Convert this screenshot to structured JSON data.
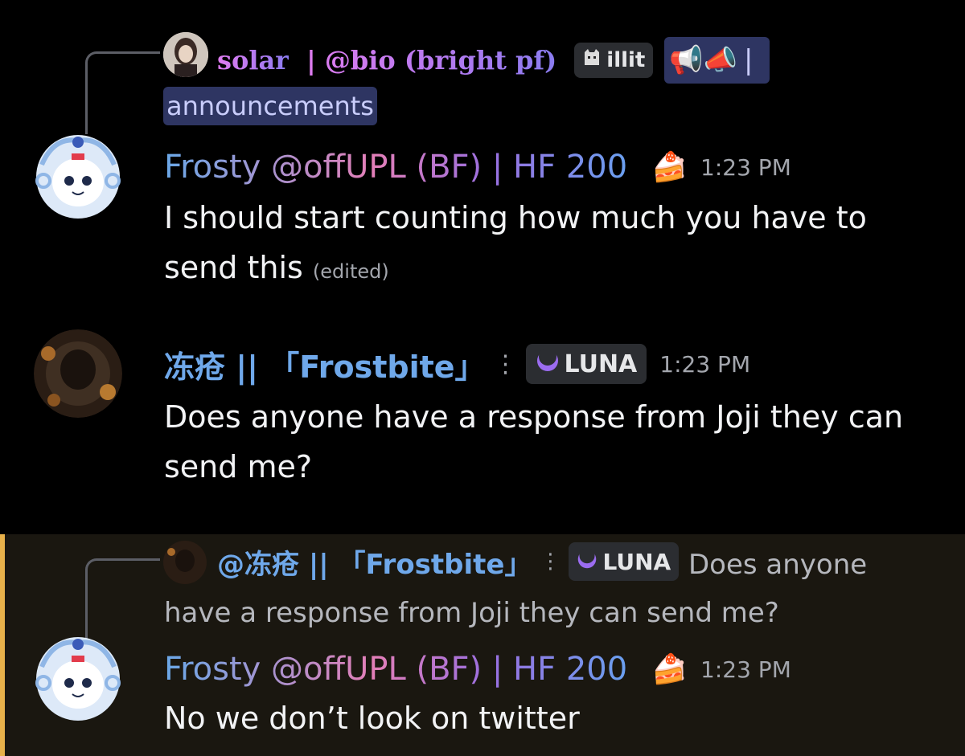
{
  "messages": [
    {
      "reply": {
        "author": "solar",
        "author_suffix": "| @bio (bright pf)",
        "tag_label": "illit",
        "tag_icon": "cat-icon",
        "channel_icons": "📢📣",
        "channel_sep": "|",
        "channel_name": "announcements"
      },
      "author": "Frosty @offUPL (BF) | HF 200",
      "author_emoji": "🍰",
      "time": "1:23 PM",
      "text": "I should start counting how much you have to send this",
      "edited": "(edited)"
    },
    {
      "author": "冻疮 || 「Frostbite」",
      "dots": "⋮",
      "tag_label": "LUNA",
      "tag_icon": "moon-icon",
      "time": "1:23 PM",
      "text": "Does anyone have a response from Joji they can send me?"
    },
    {
      "reply": {
        "author": "@冻疮 || 「Frostbite」",
        "dots": "⋮",
        "tag_label": "LUNA",
        "text": "Does anyone have a response from Joji they can send me?"
      },
      "author": "Frosty @offUPL (BF) | HF 200",
      "author_emoji": "🍰",
      "time": "1:23 PM",
      "text": "No we don’t look on twitter"
    }
  ],
  "colors": {
    "background": "#000000",
    "mention_highlight": "#1a1710",
    "mention_bar": "#e8b14a",
    "timestamp": "#a3a6ad",
    "tag_bg": "#2b2d31",
    "channel_pill_bg": "#2e3562"
  }
}
